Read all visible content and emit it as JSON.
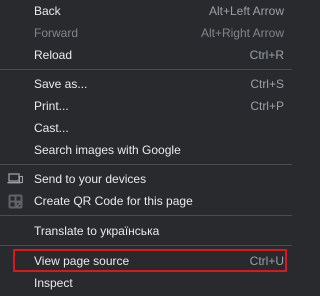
{
  "menu": {
    "back": {
      "label": "Back",
      "shortcut": "Alt+Left Arrow"
    },
    "forward": {
      "label": "Forward",
      "shortcut": "Alt+Right Arrow"
    },
    "reload": {
      "label": "Reload",
      "shortcut": "Ctrl+R"
    },
    "save_as": {
      "label": "Save as...",
      "shortcut": "Ctrl+S"
    },
    "print": {
      "label": "Print...",
      "shortcut": "Ctrl+P"
    },
    "cast": {
      "label": "Cast..."
    },
    "search_images": {
      "label": "Search images with Google"
    },
    "send_to_devices": {
      "label": "Send to your devices",
      "icon": "devices-icon"
    },
    "qr_code": {
      "label": "Create QR Code for this page",
      "icon": "qr-code-icon"
    },
    "translate": {
      "label": "Translate to українська"
    },
    "view_source": {
      "label": "View page source",
      "shortcut": "Ctrl+U"
    },
    "inspect": {
      "label": "Inspect"
    }
  },
  "colors": {
    "background": "#292a2d",
    "text": "#e8eaed",
    "disabled_text": "#80868b",
    "highlight_border": "#e0141e"
  }
}
